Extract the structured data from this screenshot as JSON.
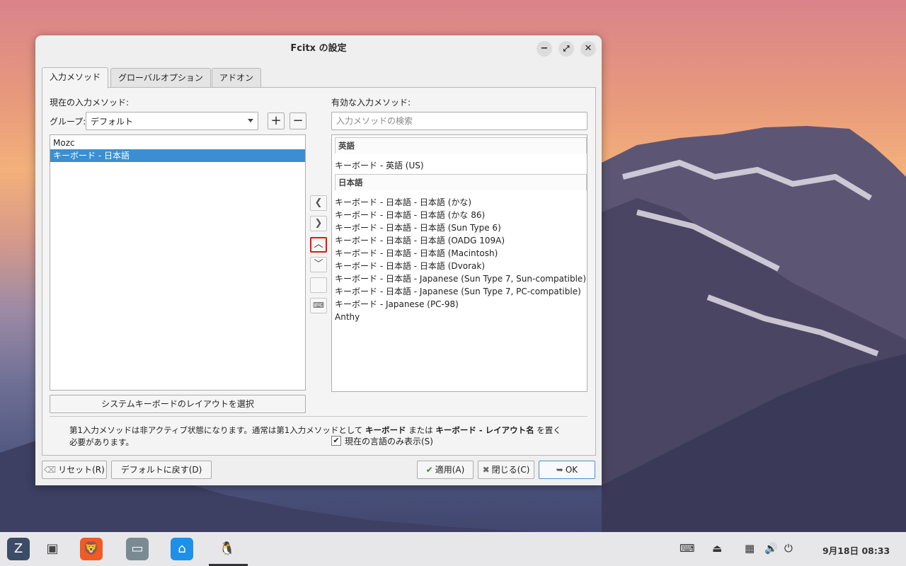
{
  "window": {
    "title": "Fcitx の設定",
    "minimize_icon": "minimize-icon",
    "maximize_icon": "maximize-icon",
    "close_icon": "close-icon"
  },
  "tabs": [
    {
      "label": "入力メソッド",
      "active": true
    },
    {
      "label": "グローバルオプション",
      "active": false
    },
    {
      "label": "アドオン",
      "active": false
    }
  ],
  "left": {
    "current_label": "現在の入力メソッド:",
    "group_label": "グループ:",
    "group_value": "デフォルト",
    "items": [
      "Mozc",
      "キーボード - 日本語"
    ],
    "selected_index": 1,
    "layout_button": "システムキーボードのレイアウトを選択"
  },
  "right": {
    "available_label": "有効な入力メソッド:",
    "search_placeholder": "入力メソッドの検索",
    "group_english": "英語",
    "english_items": [
      "キーボード - 英語 (US)"
    ],
    "group_japanese": "日本語",
    "japanese_items": [
      "キーボード - 日本語 - 日本語 (かな)",
      "キーボード - 日本語 - 日本語 (かな 86)",
      "キーボード - 日本語 - 日本語 (Sun Type 6)",
      "キーボード - 日本語 - 日本語 (OADG 109A)",
      "キーボード - 日本語 - 日本語 (Macintosh)",
      "キーボード - 日本語 - 日本語 (Dvorak)",
      "キーボード - 日本語 - Japanese (Sun Type 7, Sun-compatible)",
      "キーボード - 日本語 - Japanese (Sun Type 7, PC-compatible)",
      "キーボード - Japanese (PC-98)",
      "Anthy"
    ],
    "show_current_lang": "現在の言語のみ表示(S)",
    "show_current_lang_checked": true
  },
  "info": {
    "text1": "第1入力メソッドは非アクティブ状態になります。通常は第1入力メソッドとして",
    "bold1": "キーボード",
    "text2": "または",
    "bold2": "キーボード - レイアウト名",
    "text3": "を置く必要があります。"
  },
  "buttons": {
    "reset": "リセット(R)",
    "defaults": "デフォルトに戻す(D)",
    "apply": "適用(A)",
    "close": "閉じる(C)",
    "ok": "OK"
  },
  "taskbar": {
    "clock": "9月18日 08:33"
  },
  "colors": {
    "selection": "#3b8fd0",
    "highlight_border": "#e11111"
  }
}
